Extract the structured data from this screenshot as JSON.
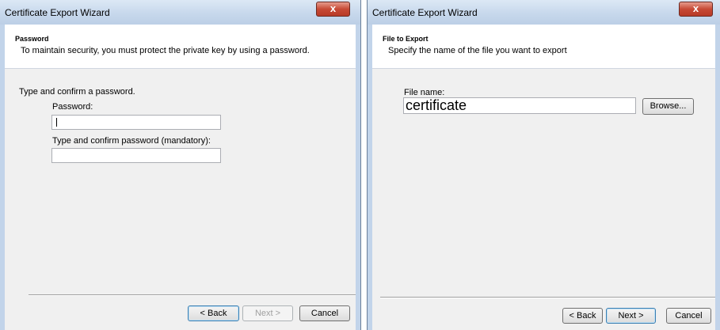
{
  "left_window": {
    "title": "Certificate Export Wizard",
    "close_label": "x",
    "header_title": "Password",
    "header_subtitle": "To maintain security, you must protect the private key by using a password.",
    "instruction": "Type and confirm a password.",
    "password_label": "Password:",
    "password_value": "",
    "confirm_label": "Type and confirm password (mandatory):",
    "confirm_value": "",
    "back_label": "< Back",
    "next_label": "Next >",
    "cancel_label": "Cancel"
  },
  "right_window": {
    "title": "Certificate Export Wizard",
    "close_label": "x",
    "header_title": "File to Export",
    "header_subtitle": "Specify the name of the file you want to export",
    "filename_label": "File name:",
    "filename_value": "certificate",
    "browse_label": "Browse...",
    "back_label": "< Back",
    "next_label": "Next >",
    "cancel_label": "Cancel"
  },
  "colors": {
    "title_bar": "#c7d8ec",
    "close_button": "#c74a36",
    "content_background": "#f0f0f0"
  }
}
